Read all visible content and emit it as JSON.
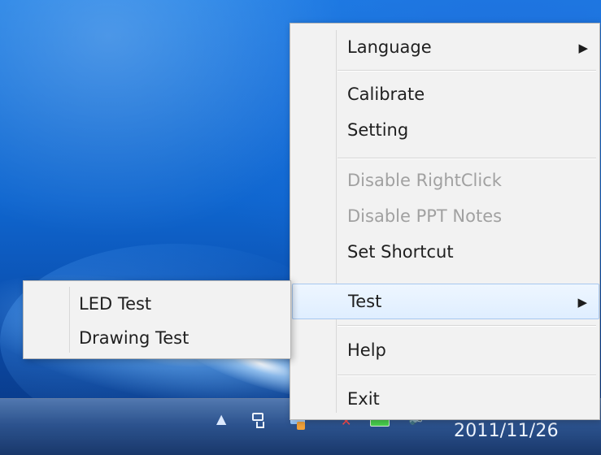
{
  "main_menu": {
    "items": [
      {
        "label": "Language",
        "enabled": true,
        "has_submenu": true
      },
      {
        "label": "Calibrate",
        "enabled": true,
        "has_submenu": false
      },
      {
        "label": "Setting",
        "enabled": true,
        "has_submenu": false
      },
      {
        "label": "Disable RightClick",
        "enabled": false,
        "has_submenu": false
      },
      {
        "label": "Disable PPT Notes",
        "enabled": false,
        "has_submenu": false
      },
      {
        "label": "Set Shortcut",
        "enabled": true,
        "has_submenu": false
      },
      {
        "label": "Test",
        "enabled": true,
        "has_submenu": true,
        "highlighted": true
      },
      {
        "label": "Help",
        "enabled": true,
        "has_submenu": false
      },
      {
        "label": "Exit",
        "enabled": true,
        "has_submenu": false
      }
    ]
  },
  "submenu": {
    "items": [
      {
        "label": "LED Test"
      },
      {
        "label": "Drawing Test"
      }
    ]
  },
  "taskbar": {
    "date": "2011/11/26",
    "icons": [
      "show-hidden-icons-arrow",
      "network-icon",
      "app-icon",
      "error-icon",
      "battery-icon",
      "speaker-icon"
    ]
  },
  "symbols": {
    "submenu_arrow": "▶",
    "tray_arrow": "▲"
  }
}
